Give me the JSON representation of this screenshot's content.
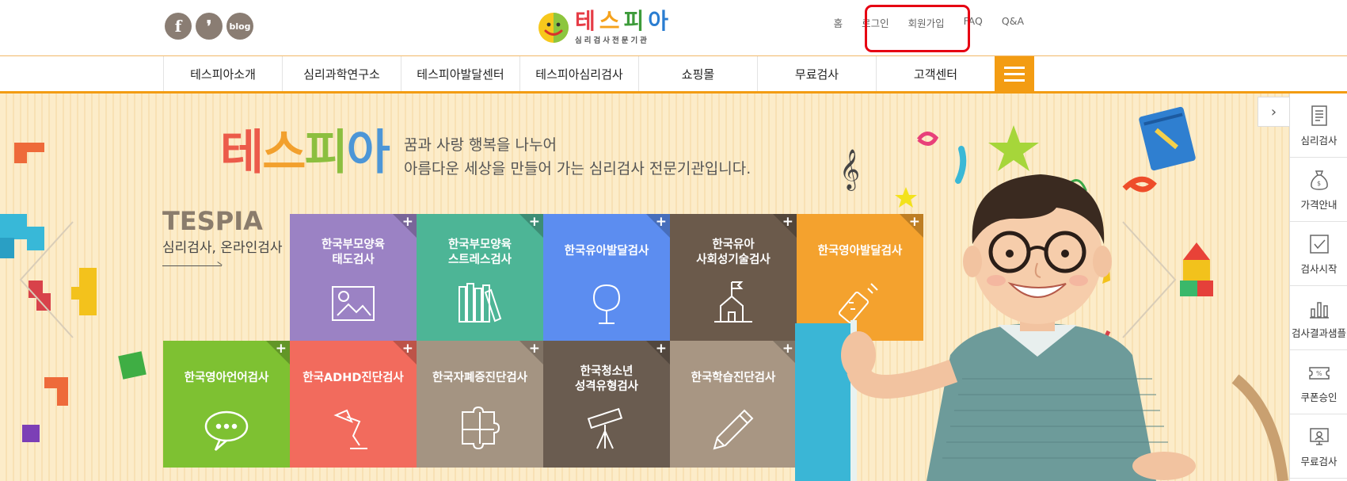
{
  "header": {
    "social": [
      {
        "name": "facebook",
        "glyph": "f"
      },
      {
        "name": "kakaostory",
        "glyph": "❜"
      },
      {
        "name": "blog",
        "glyph": "blog"
      }
    ],
    "logo": {
      "chars": [
        "테",
        "스",
        "피",
        "아"
      ],
      "sub": "심리검사전문기관"
    },
    "util_nav": [
      "홈",
      "로그인",
      "회원가입",
      "FAQ",
      "Q&A"
    ]
  },
  "gnb": {
    "items": [
      "테스피아소개",
      "심리과학연구소",
      "테스피아발달센터",
      "테스피아심리검사",
      "쇼핑몰",
      "무료검사",
      "고객센터"
    ]
  },
  "hero": {
    "brand": [
      "테",
      "스",
      "피",
      "아"
    ],
    "slogan_line1": "꿈과 사랑 행복을 나누어",
    "slogan_line2": "아름다운 세상을 만들어 가는 심리검사 전문기관입니다.",
    "tespia": "TESPIA",
    "tespia_sub": "심리검사, 온라인검사",
    "tiles": [
      {
        "line1": "한국부모양육",
        "line2": "태도검사",
        "color": "#9b82c4",
        "icon": "picture-icon"
      },
      {
        "line1": "한국부모양육",
        "line2": "스트레스검사",
        "color": "#4db596",
        "icon": "books-icon"
      },
      {
        "line1": "한국유아발달검사",
        "line2": "",
        "color": "#5c8df0",
        "icon": "tree-icon"
      },
      {
        "line1": "한국유아",
        "line2": "사회성기술검사",
        "color": "#6b5a4b",
        "icon": "school-icon"
      },
      {
        "line1": "한국영아발달검사",
        "line2": "",
        "color": "#f4a22e",
        "icon": "baby-bottle-icon"
      },
      {
        "line1": "한국영아언어검사",
        "line2": "",
        "color": "#7ec132",
        "icon": "speech-bubble-icon"
      },
      {
        "line1": "한국ADHD진단검사",
        "line2": "",
        "color": "#f26b5d",
        "icon": "lamp-icon"
      },
      {
        "line1": "한국자폐증진단검사",
        "line2": "",
        "color": "#a49482",
        "icon": "puzzle-icon"
      },
      {
        "line1": "한국청소년",
        "line2": "성격유형검사",
        "color": "#6a5c50",
        "icon": "telescope-icon"
      },
      {
        "line1": "한국학습진단검사",
        "line2": "",
        "color": "#a89683",
        "icon": "pencil-icon"
      }
    ],
    "plus": "+"
  },
  "quick_menu": {
    "toggle": "›",
    "items": [
      "심리검사",
      "가격안내",
      "검사시작",
      "검사결과샘플",
      "쿠폰승인",
      "무료검사"
    ]
  }
}
